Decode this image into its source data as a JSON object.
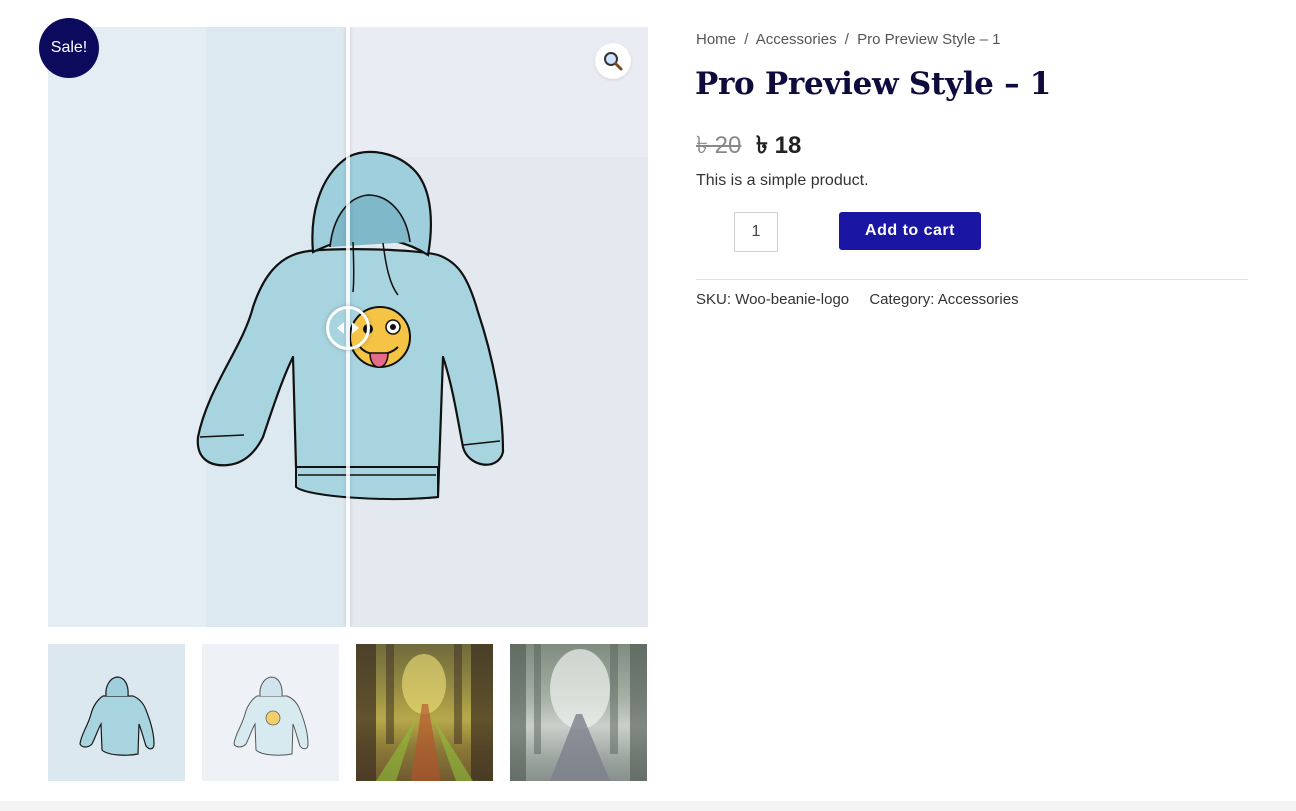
{
  "sale_badge": "Sale!",
  "breadcrumb": {
    "home": "Home",
    "separator": "/",
    "category": "Accessories",
    "current": "Pro Preview Style – 1"
  },
  "product": {
    "title": "Pro Preview Style – 1",
    "price_old": "৳ 20",
    "price_new": "৳ 18",
    "short_description": "This is a simple product.",
    "quantity": "1",
    "add_to_cart_label": "Add to cart",
    "sku_label": "SKU:",
    "sku_value": "Woo-beanie-logo",
    "category_label": "Category:",
    "category_value": "Accessories"
  },
  "gallery": {
    "zoom_icon": "magnifier-icon",
    "compare_handle_icon": "left-right-arrows-icon",
    "thumbnails": [
      {
        "name": "hoodie-plain"
      },
      {
        "name": "hoodie-emoji"
      },
      {
        "name": "forest-path-sunlit"
      },
      {
        "name": "forest-road-misty"
      }
    ]
  },
  "colors": {
    "accent": "#1a15a3",
    "badge": "#0c0a5c",
    "title": "#0e0b3d"
  }
}
